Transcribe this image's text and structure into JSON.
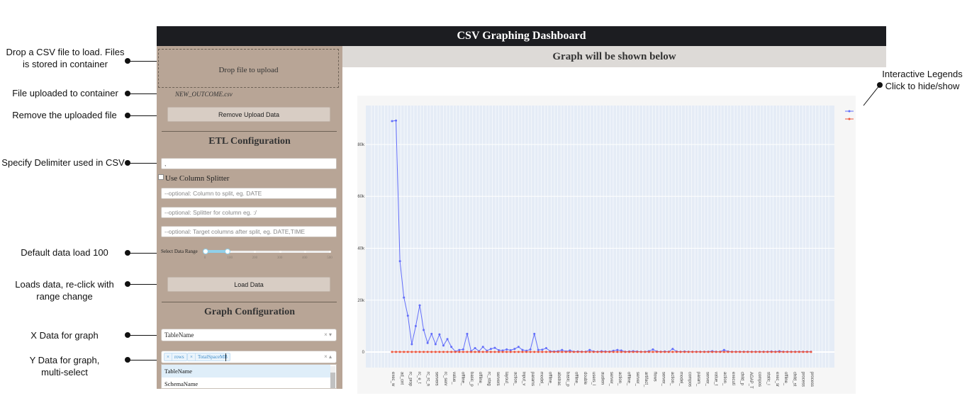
{
  "annotations": {
    "drop_csv": [
      "Drop a CSV file to load. Files",
      "is stored in container"
    ],
    "file_uploaded": "File uploaded to container",
    "remove_file": "Remove the uploaded file",
    "delimiter": "Specify Delimiter used in CSV",
    "default_load": "Default data load 100",
    "loads_data": [
      "Loads data, re-click with",
      "range change"
    ],
    "x_data": "X Data for graph",
    "y_data": [
      "Y Data for graph,",
      "multi-select"
    ],
    "legend_note": [
      "Interactive Legends",
      "Click to hide/show"
    ]
  },
  "app": {
    "title": "CSV Graphing Dashboard",
    "graph_header": "Graph will be shown below"
  },
  "sidebar": {
    "dropzone_text": "Drop file to upload",
    "filename": "NEW_OUTCOME.csv",
    "remove_button": "Remove Upload Data",
    "etl_title": "ETL Configuration",
    "delimiter_value": ",",
    "use_column_splitter": "Use Column Splitter",
    "split_column_placeholder": "--optional: Column to split, eg. DATE",
    "splitter_placeholder": "--optional: Splitter for column eg. :/",
    "target_columns_placeholder": "--optional: Target columns after split, eg. DATE,TIME",
    "slider_label": "Select Data Range",
    "slider_value": [
      0,
      100
    ],
    "slider_ticks": [
      "0",
      "100",
      "200",
      "300",
      "400",
      "500"
    ],
    "load_button": "Load Data",
    "graph_title": "Graph Configuration",
    "x_select_value": "TableName",
    "select_clear": "×",
    "select_arrow": "▾",
    "select_arrow_up": "▴",
    "y_tags": [
      "rows",
      "TotalSpaceMB"
    ],
    "tag_remove": "×",
    "y_options": [
      "TableName",
      "SchemaName"
    ]
  },
  "chart_data": {
    "type": "line",
    "ylim": [
      -6000,
      95000
    ],
    "y_ticks": [
      "0",
      "20k",
      "40k",
      "60k",
      "80k"
    ],
    "categories": [
      "exec_w",
      "ad_cnt",
      "rc_prop",
      "rc_e_t",
      "rc_rc_n",
      "servers",
      "rc_serv",
      "value_",
      "offline_",
      "basic_p",
      "offline_",
      "rc_stag",
      "servers",
      "layout_",
      "action_",
      "input_v",
      "params",
      "model_",
      "offline_",
      "abstrac",
      "basic_p",
      "offline_",
      "double",
      "users_l",
      "audien",
      "server_",
      "action_",
      "offline_",
      "server_",
      "artifact_",
      "flows",
      "server_",
      "action_",
      "model_",
      "compos",
      "param_",
      "server_",
      "value_t",
      "action_",
      "executi",
      "child_p",
      "AGAP_T",
      "compos",
      "static_i",
      "exec_sr",
      "offline_",
      "child_st",
      "process",
      "process"
    ],
    "series": [
      {
        "name": "rows",
        "color": "#636efa",
        "values": [
          89000,
          89200,
          35000,
          21000,
          14000,
          3000,
          10000,
          18000,
          8500,
          3500,
          7000,
          3000,
          6800,
          2500,
          5000,
          2000,
          200,
          800,
          1000,
          7000,
          300,
          1500,
          300,
          2000,
          500,
          1200,
          1600,
          700,
          600,
          1000,
          700,
          1200,
          2000,
          800,
          500,
          1000,
          7000,
          800,
          900,
          1500,
          300,
          200,
          300,
          800,
          200,
          600,
          100,
          200,
          150,
          100,
          800,
          200,
          100,
          300,
          200,
          150,
          500,
          800,
          600,
          100,
          200,
          300,
          200,
          100,
          100,
          300,
          1000,
          200,
          100,
          200,
          100,
          1200,
          200,
          100,
          200,
          100,
          100,
          100,
          100,
          100,
          100,
          300,
          100,
          100,
          800,
          200,
          100,
          100,
          100,
          100,
          100,
          100,
          100,
          100,
          100,
          100,
          200,
          100,
          300,
          100,
          100,
          100,
          100,
          100,
          100,
          100,
          100
        ]
      },
      {
        "name": "TotalSpaceMB",
        "color": "#ef553b",
        "values": [
          50,
          50,
          50,
          50,
          50,
          50,
          50,
          50,
          50,
          50,
          50,
          50,
          50,
          50,
          50,
          50,
          50,
          50,
          50,
          50,
          50,
          50,
          50,
          50,
          50,
          50,
          50,
          50,
          50,
          50,
          50,
          50,
          50,
          50,
          50,
          50,
          50,
          50,
          50,
          50,
          50,
          50,
          50,
          50,
          50,
          50,
          50,
          50,
          50,
          50,
          50,
          50,
          50,
          50,
          50,
          50,
          50,
          50,
          50,
          50,
          50,
          50,
          50,
          50,
          50,
          50,
          50,
          50,
          50,
          50,
          50,
          50,
          50,
          50,
          50,
          50,
          50,
          50,
          50,
          50,
          50,
          50,
          50,
          50,
          50,
          50,
          50,
          50,
          50,
          50,
          50,
          50,
          50,
          50,
          50,
          50,
          50,
          50,
          50,
          50,
          50,
          50,
          50,
          50,
          50,
          50,
          50
        ]
      }
    ],
    "grid": true,
    "legend_position": "right"
  }
}
